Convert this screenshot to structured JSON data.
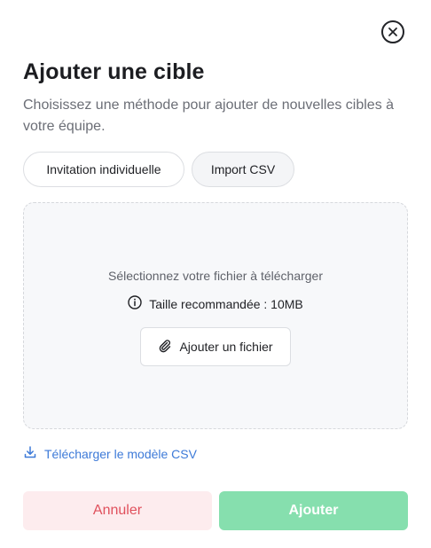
{
  "dialog": {
    "title": "Ajouter une cible",
    "subtitle": "Choisissez une méthode pour ajouter de nouvelles cibles à votre équipe."
  },
  "tabs": [
    {
      "label": "Invitation individuelle"
    },
    {
      "label": "Import CSV"
    }
  ],
  "upload": {
    "prompt": "Sélectionnez votre fichier à télécharger",
    "size_hint": "Taille recommandée : 10MB",
    "add_file_label": "Ajouter un fichier"
  },
  "download_template_label": "Télécharger le modèle CSV",
  "footer": {
    "cancel_label": "Annuler",
    "submit_label": "Ajouter"
  },
  "icons": {
    "close": "close-circle-icon",
    "info": "info-icon",
    "attach": "paperclip-icon",
    "download": "download-icon"
  },
  "colors": {
    "accent_link": "#3d7ad8",
    "cancel_bg": "#fdecee",
    "cancel_text": "#e0505c",
    "submit_bg": "#86dfae",
    "submit_text": "#ffffff"
  }
}
